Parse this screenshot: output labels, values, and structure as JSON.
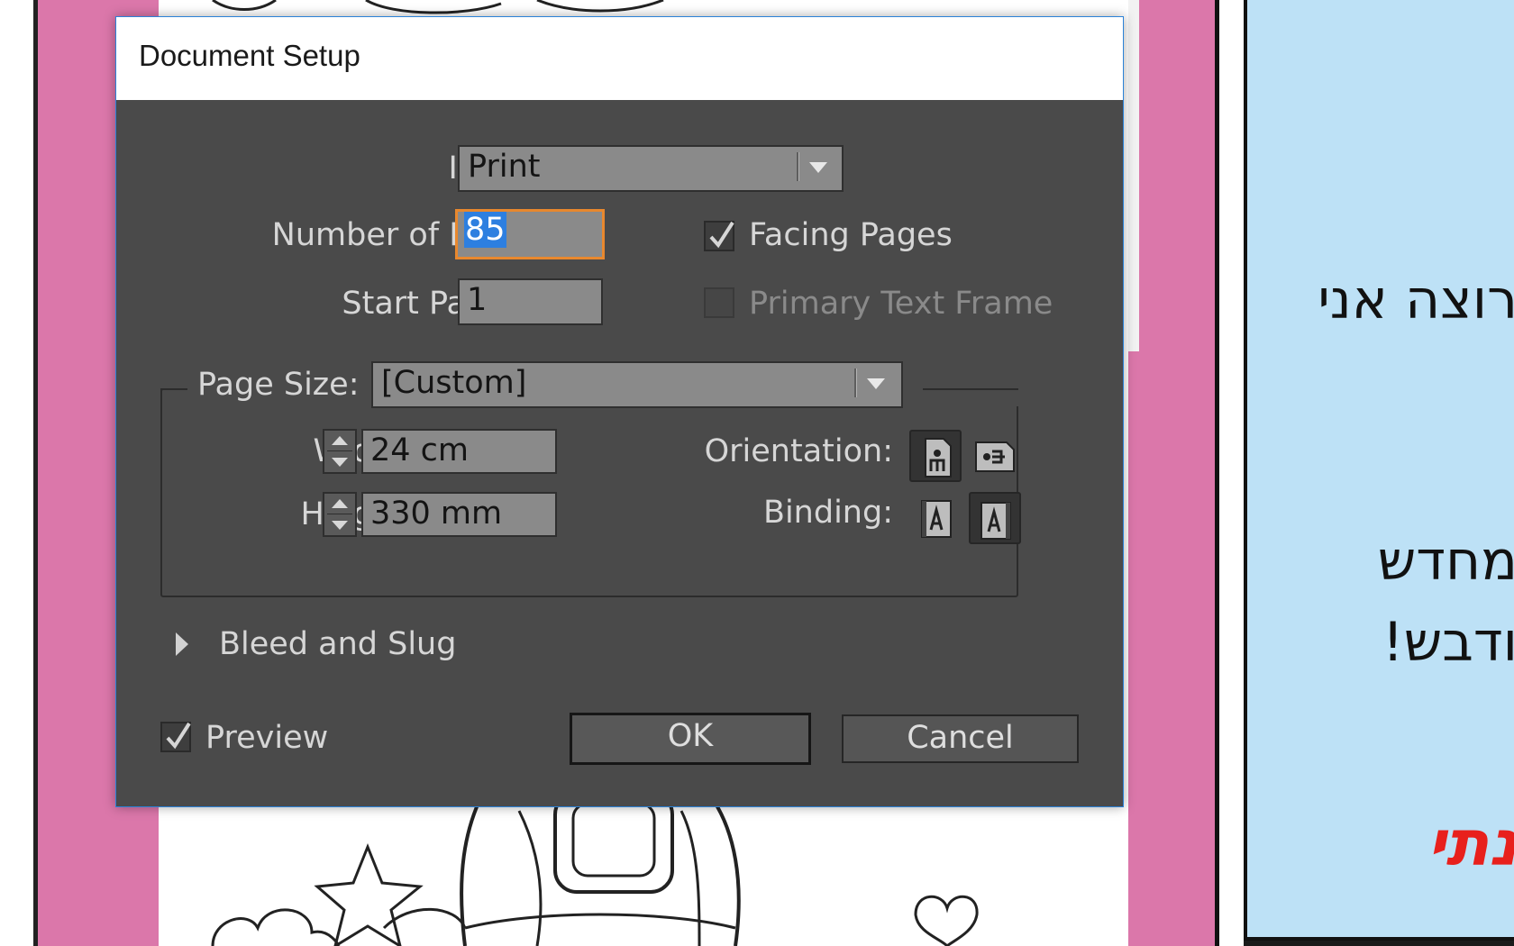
{
  "dialog": {
    "title": "Document Setup",
    "intent": {
      "label": "Intent:",
      "value": "Print"
    },
    "pages": {
      "label": "Number of Pages:",
      "value": "85"
    },
    "start_page": {
      "label": "Start Page #:",
      "value": "1"
    },
    "facing_pages": {
      "label": "Facing Pages",
      "checked": true
    },
    "primary_text_frame": {
      "label": "Primary Text Frame",
      "checked": false,
      "enabled": false
    },
    "page_size": {
      "label": "Page Size:",
      "value": "[Custom]"
    },
    "width": {
      "label": "Width:",
      "value": "24 cm"
    },
    "height": {
      "label": "Height:",
      "value": "330 mm"
    },
    "orientation": {
      "label": "Orientation:",
      "selected": "portrait"
    },
    "binding": {
      "label": "Binding:",
      "selected": "right-to-left"
    },
    "bleed_slug": {
      "label": "Bleed and Slug",
      "expanded": false
    },
    "preview": {
      "label": "Preview",
      "checked": true
    },
    "ok_label": "OK",
    "cancel_label": "Cancel"
  },
  "background": {
    "hebrew_lines": [
      "רוצה אני",
      "מחדש",
      "ודבש!",
      "נתי"
    ]
  },
  "colors": {
    "dialog_bg": "#4a4a4a",
    "focus_ring": "#e8882e",
    "selection": "#2d7fe0",
    "dialog_border": "#2b82d8",
    "pink_page": "#db77aa",
    "blue_panel": "#bde1f6",
    "hebrew_accent": "#e8201c"
  }
}
